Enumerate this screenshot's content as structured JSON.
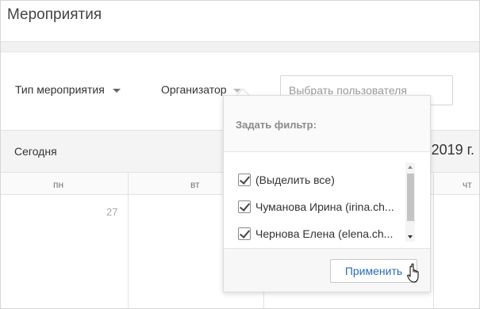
{
  "page": {
    "title": "Мероприятия"
  },
  "filters": {
    "event_type_label": "Тип мероприятия",
    "organizer_label": "Организатор",
    "user_search_placeholder": "Выбрать пользователя"
  },
  "calendar": {
    "today_label": "Сегодня",
    "period_label": "2019 г.",
    "day_names": [
      "пн",
      "вт",
      "чт"
    ],
    "first_cell_date": "27"
  },
  "dropdown": {
    "header": "Задать фильтр:",
    "options": [
      {
        "label": "(Выделить все)",
        "checked": true
      },
      {
        "label": "Чуманова Ирина (irina.ch...",
        "checked": true
      },
      {
        "label": "Чернова Елена (elena.ch...",
        "checked": true
      }
    ],
    "apply_label": "Применить"
  },
  "colors": {
    "accent_link": "#2a6bb8",
    "header_bg": "#f4f4f4"
  },
  "icons": {
    "dropdown_caret": "chevron-down-icon",
    "checkbox": "checkmark-icon",
    "pointer": "hand-cursor-icon"
  }
}
